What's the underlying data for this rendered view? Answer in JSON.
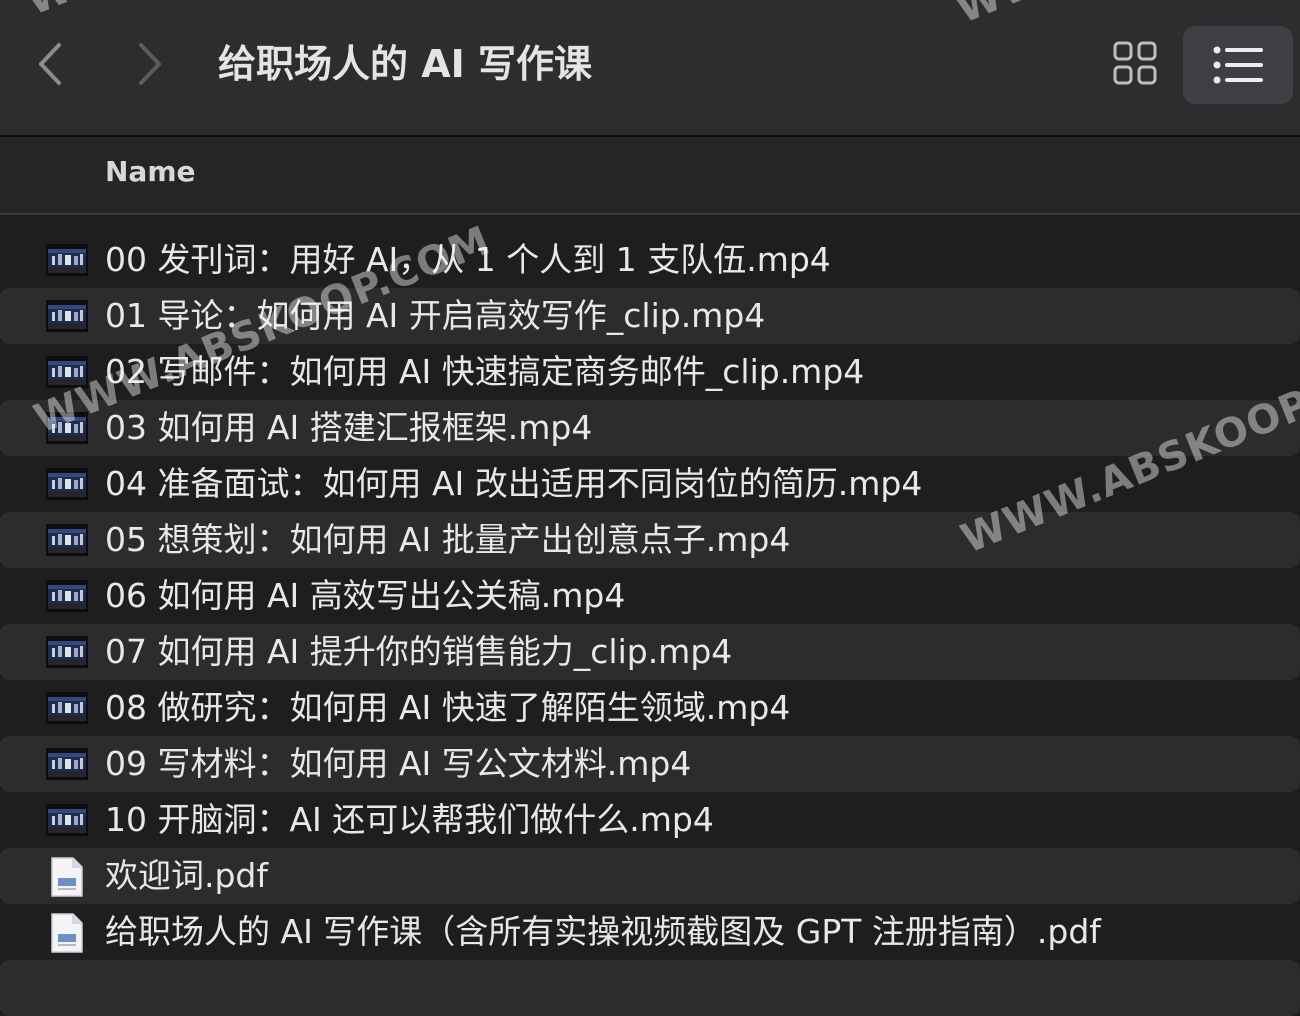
{
  "window": {
    "title": "给职场人的 AI 写作课"
  },
  "columns": {
    "name": "Name"
  },
  "files": [
    {
      "name": "00 发刊词：用好 AI，从 1 个人到 1 支队伍.mp4",
      "type": "video"
    },
    {
      "name": "01 导论：如何用 AI 开启高效写作_clip.mp4",
      "type": "video"
    },
    {
      "name": "02 写邮件：如何用 AI 快速搞定商务邮件_clip.mp4",
      "type": "video"
    },
    {
      "name": "03 如何用 AI 搭建汇报框架.mp4",
      "type": "video"
    },
    {
      "name": "04 准备面试：如何用 AI 改出适用不同岗位的简历.mp4",
      "type": "video"
    },
    {
      "name": "05 想策划：如何用 AI 批量产出创意点子.mp4",
      "type": "video"
    },
    {
      "name": "06 如何用 AI 高效写出公关稿.mp4",
      "type": "video"
    },
    {
      "name": "07 如何用 AI 提升你的销售能力_clip.mp4",
      "type": "video"
    },
    {
      "name": "08 做研究：如何用 AI 快速了解陌生领域.mp4",
      "type": "video"
    },
    {
      "name": "09 写材料：如何用 AI 写公文材料.mp4",
      "type": "video"
    },
    {
      "name": "10 开脑洞：AI 还可以帮我们做什么.mp4",
      "type": "video"
    },
    {
      "name": "欢迎词.pdf",
      "type": "pdf"
    },
    {
      "name": "给职场人的 AI 写作课（含所有实操视频截图及 GPT 注册指南）.pdf",
      "type": "pdf"
    }
  ],
  "watermark": {
    "text": "WWW.ABSKOOP.COM"
  },
  "icons": {
    "back": "chevron-left-icon",
    "forward": "chevron-right-icon",
    "grid_view": "grid-view-icon",
    "list_view": "list-view-icon",
    "video": "video-thumbnail-icon",
    "pdf": "pdf-document-icon"
  },
  "colors": {
    "background": "#1e1e21",
    "toolbar": "#2d2c2f",
    "row_alt": "#2c2b2e",
    "text": "#e8e8e8"
  }
}
